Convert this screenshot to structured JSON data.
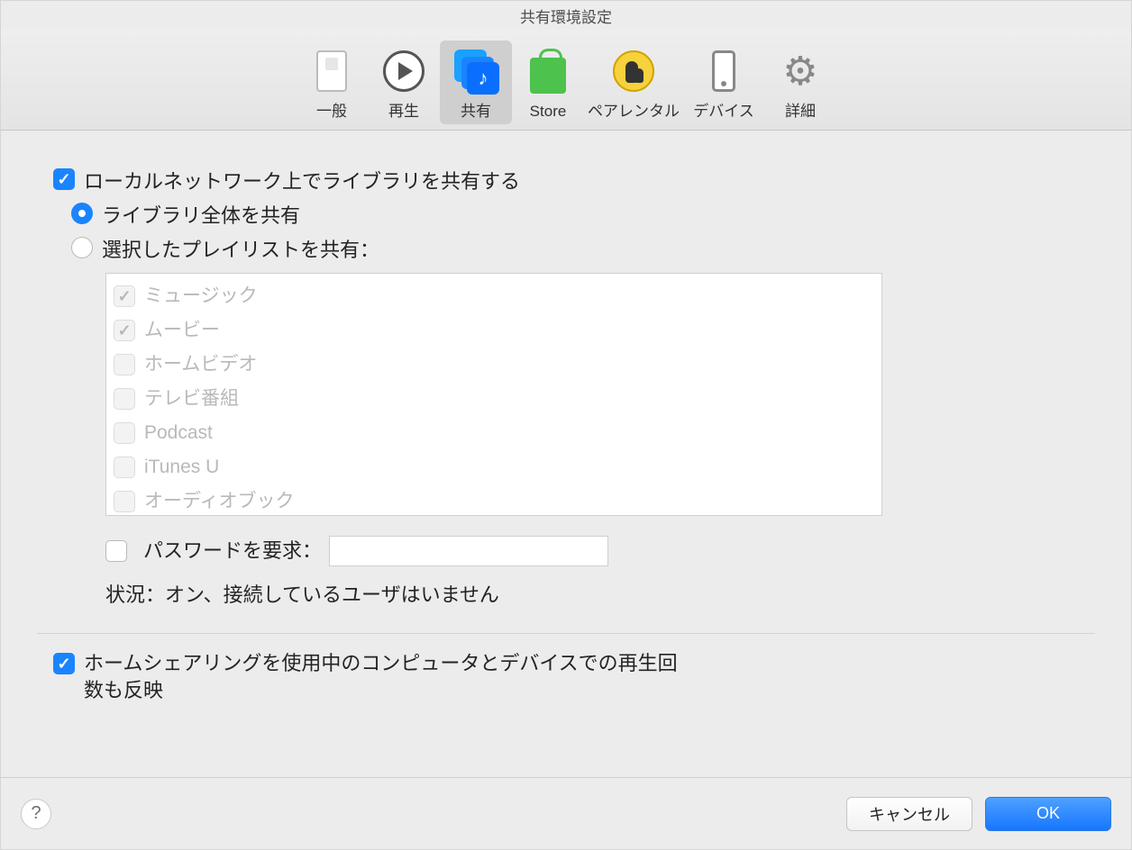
{
  "window": {
    "title": "共有環境設定"
  },
  "toolbar": {
    "tabs": [
      {
        "label": "一般"
      },
      {
        "label": "再生"
      },
      {
        "label": "共有"
      },
      {
        "label": "Store"
      },
      {
        "label": "ペアレンタル"
      },
      {
        "label": "デバイス"
      },
      {
        "label": "詳細"
      }
    ],
    "active_index": 2
  },
  "sharing": {
    "share_library_label": "ローカルネットワーク上でライブラリを共有する",
    "share_library_checked": true,
    "radio_share_all_label": "ライブラリ全体を共有",
    "radio_share_selected_label": "選択したプレイリストを共有：",
    "radio_selected": "all",
    "playlists": [
      {
        "label": "ミュージック",
        "checked": true
      },
      {
        "label": "ムービー",
        "checked": true
      },
      {
        "label": "ホームビデオ",
        "checked": false
      },
      {
        "label": "テレビ番組",
        "checked": false
      },
      {
        "label": "Podcast",
        "checked": false
      },
      {
        "label": "iTunes U",
        "checked": false
      },
      {
        "label": "オーディオブック",
        "checked": false
      }
    ],
    "password_label": "パスワードを要求：",
    "password_checked": false,
    "password_value": "",
    "status_text": "状況：オン、接続しているユーザはいません"
  },
  "home_sharing": {
    "label": "ホームシェアリングを使用中のコンピュータとデバイスでの再生回数も反映",
    "checked": true
  },
  "footer": {
    "help_tooltip": "?",
    "cancel_label": "キャンセル",
    "ok_label": "OK"
  }
}
